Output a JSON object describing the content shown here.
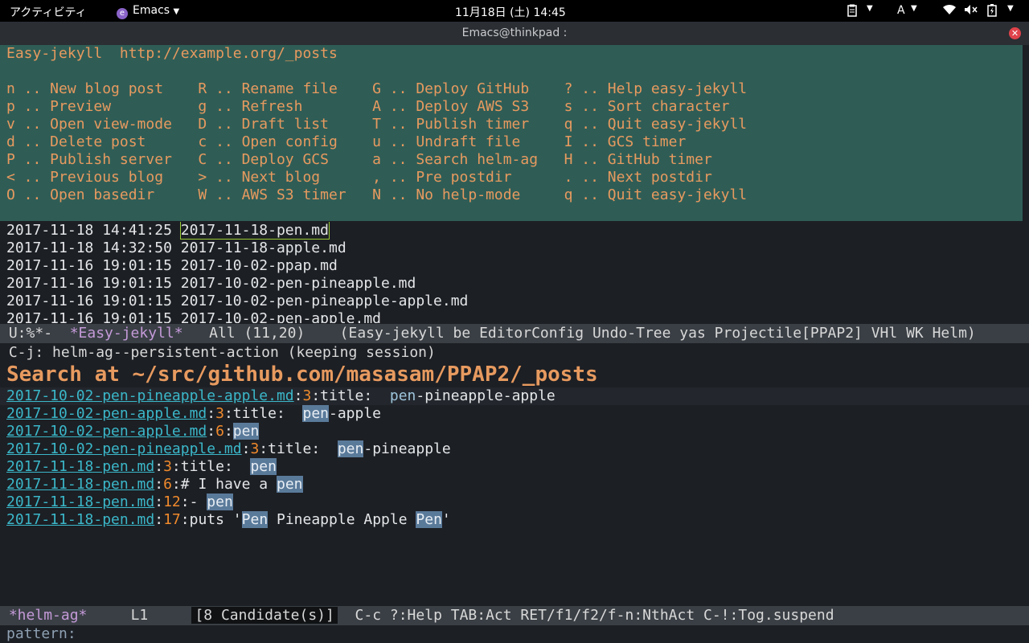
{
  "topbar": {
    "activities": "アクティビティ",
    "app": "Emacs",
    "clock": "11月18日 (土) 14:45",
    "input_method": "A",
    "icons": [
      "clipboard-icon",
      "wifi-icon",
      "volume-muted-icon",
      "battery-icon"
    ]
  },
  "window": {
    "title": "Emacs@thinkpad :"
  },
  "menu": {
    "header": "Easy-jekyll  http://example.org/_posts",
    "rows": [
      "n .. New blog post    R .. Rename file    G .. Deploy GitHub    ? .. Help easy-jekyll",
      "p .. Preview          g .. Refresh        A .. Deploy AWS S3    s .. Sort character",
      "v .. Open view-mode   D .. Draft list     T .. Publish timer    q .. Quit easy-jekyll",
      "d .. Delete post      c .. Open config    u .. Undraft file     I .. GCS timer",
      "P .. Publish server   C .. Deploy GCS     a .. Search helm-ag   H .. GitHub timer",
      "< .. Previous blog    > .. Next blog      , .. Pre postdir      . .. Next postdir",
      "O .. Open basedir     W .. AWS S3 timer   N .. No help-mode     q .. Quit easy-jekyll"
    ]
  },
  "posts": [
    {
      "date": "2017-11-18 14:41:25",
      "file": "2017-11-18-pen.md"
    },
    {
      "date": "2017-11-18 14:32:50",
      "file": "2017-11-18-apple.md"
    },
    {
      "date": "2017-11-16 19:01:15",
      "file": "2017-10-02-ppap.md"
    },
    {
      "date": "2017-11-16 19:01:15",
      "file": "2017-10-02-pen-pineapple.md"
    },
    {
      "date": "2017-11-16 19:01:15",
      "file": "2017-10-02-pen-pineapple-apple.md"
    },
    {
      "date": "2017-11-16 19:01:15",
      "file": "2017-10-02-pen-apple.md"
    }
  ],
  "modeline1": {
    "status": "U:%*-  ",
    "buffer": "*Easy-jekyll*",
    "position": "   All (11,20)    ",
    "modes": "(Easy-jekyll be EditorConfig Undo-Tree yas Projectile[PPAP2] VHl WK Helm)"
  },
  "echo": "C-j: helm-ag--persistent-action (keeping session)",
  "helm": {
    "header": "Search at ~/src/github.com/masasam/PPAP2/_posts",
    "results": [
      {
        "file": "2017-10-02-pen-pineapple-apple.md",
        "line": "3",
        "pre": "title:  ",
        "match": "pen",
        "post": "-pineapple-apple"
      },
      {
        "file": "2017-10-02-pen-apple.md",
        "line": "3",
        "pre": "title:  ",
        "match": "pen",
        "post": "-apple"
      },
      {
        "file": "2017-10-02-pen-apple.md",
        "line": "6",
        "pre": "",
        "match": "pen",
        "post": ""
      },
      {
        "file": "2017-10-02-pen-pineapple.md",
        "line": "3",
        "pre": "title:  ",
        "match": "pen",
        "post": "-pineapple"
      },
      {
        "file": "2017-11-18-pen.md",
        "line": "3",
        "pre": "title:  ",
        "match": "pen",
        "post": ""
      },
      {
        "file": "2017-11-18-pen.md",
        "line": "6",
        "pre": "# I have a ",
        "match": "pen",
        "post": ""
      },
      {
        "file": "2017-11-18-pen.md",
        "line": "12",
        "pre": "- ",
        "match": "pen",
        "post": ""
      },
      {
        "file": "2017-11-18-pen.md",
        "line": "17",
        "pre": "puts '",
        "match": "Pen",
        "mid": " Pineapple Apple ",
        "match2": "Pen",
        "post": "'"
      }
    ]
  },
  "modeline2": {
    "buffer": "*helm-ag*",
    "line": "L1",
    "candidates": "[8 Candidate(s)]",
    "help": "C-c ?:Help TAB:Act RET/f1/f2/f-n:NthAct C-!:Tog.suspend"
  },
  "minibuffer": {
    "prompt": "pattern:"
  }
}
